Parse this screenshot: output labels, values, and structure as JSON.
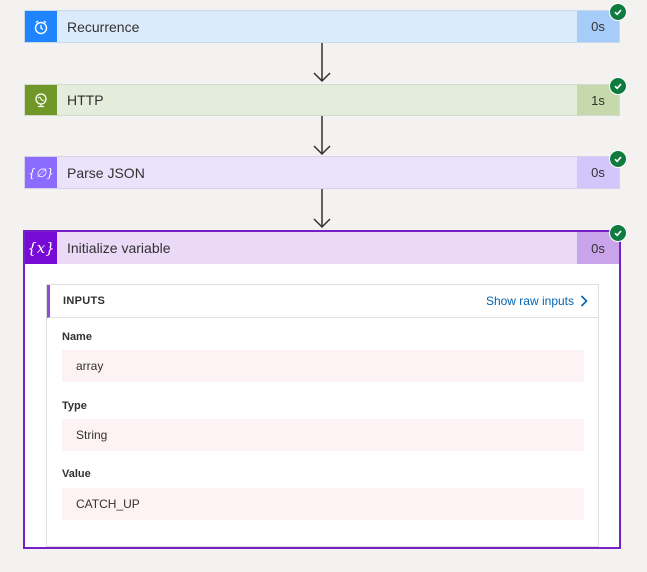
{
  "steps": [
    {
      "title": "Recurrence",
      "duration": "0s",
      "icon": "alarm-clock-icon"
    },
    {
      "title": "HTTP",
      "duration": "1s",
      "icon": "globe-icon"
    },
    {
      "title": "Parse JSON",
      "duration": "0s",
      "icon": "braces-icon"
    },
    {
      "title": "Initialize variable",
      "duration": "0s",
      "icon": "variable-icon"
    }
  ],
  "variable_icon_text": "{x}",
  "parse_icon_text": "{∅}",
  "inputs": {
    "header": "INPUTS",
    "show_raw_label": "Show raw inputs",
    "fields": [
      {
        "label": "Name",
        "value": "array"
      },
      {
        "label": "Type",
        "value": "String"
      },
      {
        "label": "Value",
        "value": "CATCH_UP"
      }
    ]
  },
  "colors": {
    "success": "#0f7b3f",
    "recurrence": "#1f85ff",
    "http": "#709727",
    "parse_json": "#8c6cff",
    "variable": "#770bd6"
  }
}
